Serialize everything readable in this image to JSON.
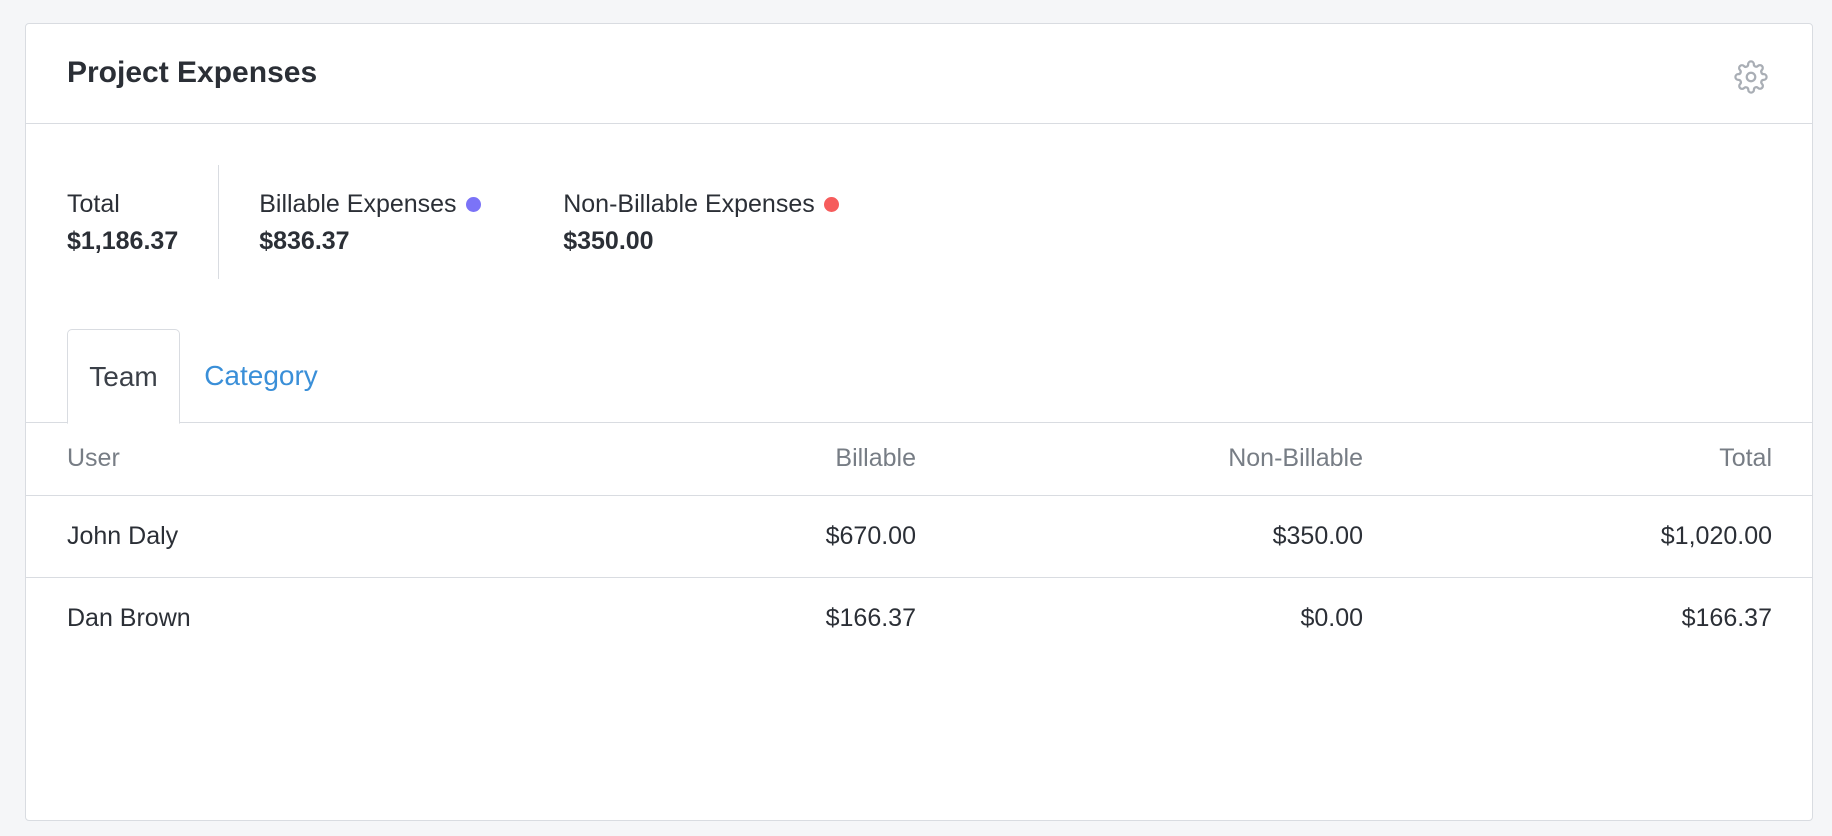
{
  "card": {
    "title": "Project Expenses",
    "settings_icon": "gear-icon"
  },
  "stats": {
    "total_label": "Total",
    "total_value": "$1,186.37",
    "billable_label": "Billable Expenses",
    "billable_value": "$836.37",
    "billable_color": "#7b73f7",
    "nonbillable_label": "Non-Billable Expenses",
    "nonbillable_value": "$350.00",
    "nonbillable_color": "#f65c5c"
  },
  "tabs": [
    {
      "label": "Team",
      "active": true
    },
    {
      "label": "Category",
      "active": false
    }
  ],
  "table": {
    "headers": [
      "User",
      "Billable",
      "Non-Billable",
      "Total"
    ],
    "rows": [
      [
        "John Daly",
        "$670.00",
        "$350.00",
        "$1,020.00"
      ],
      [
        "Dan Brown",
        "$166.37",
        "$0.00",
        "$166.37"
      ]
    ]
  }
}
